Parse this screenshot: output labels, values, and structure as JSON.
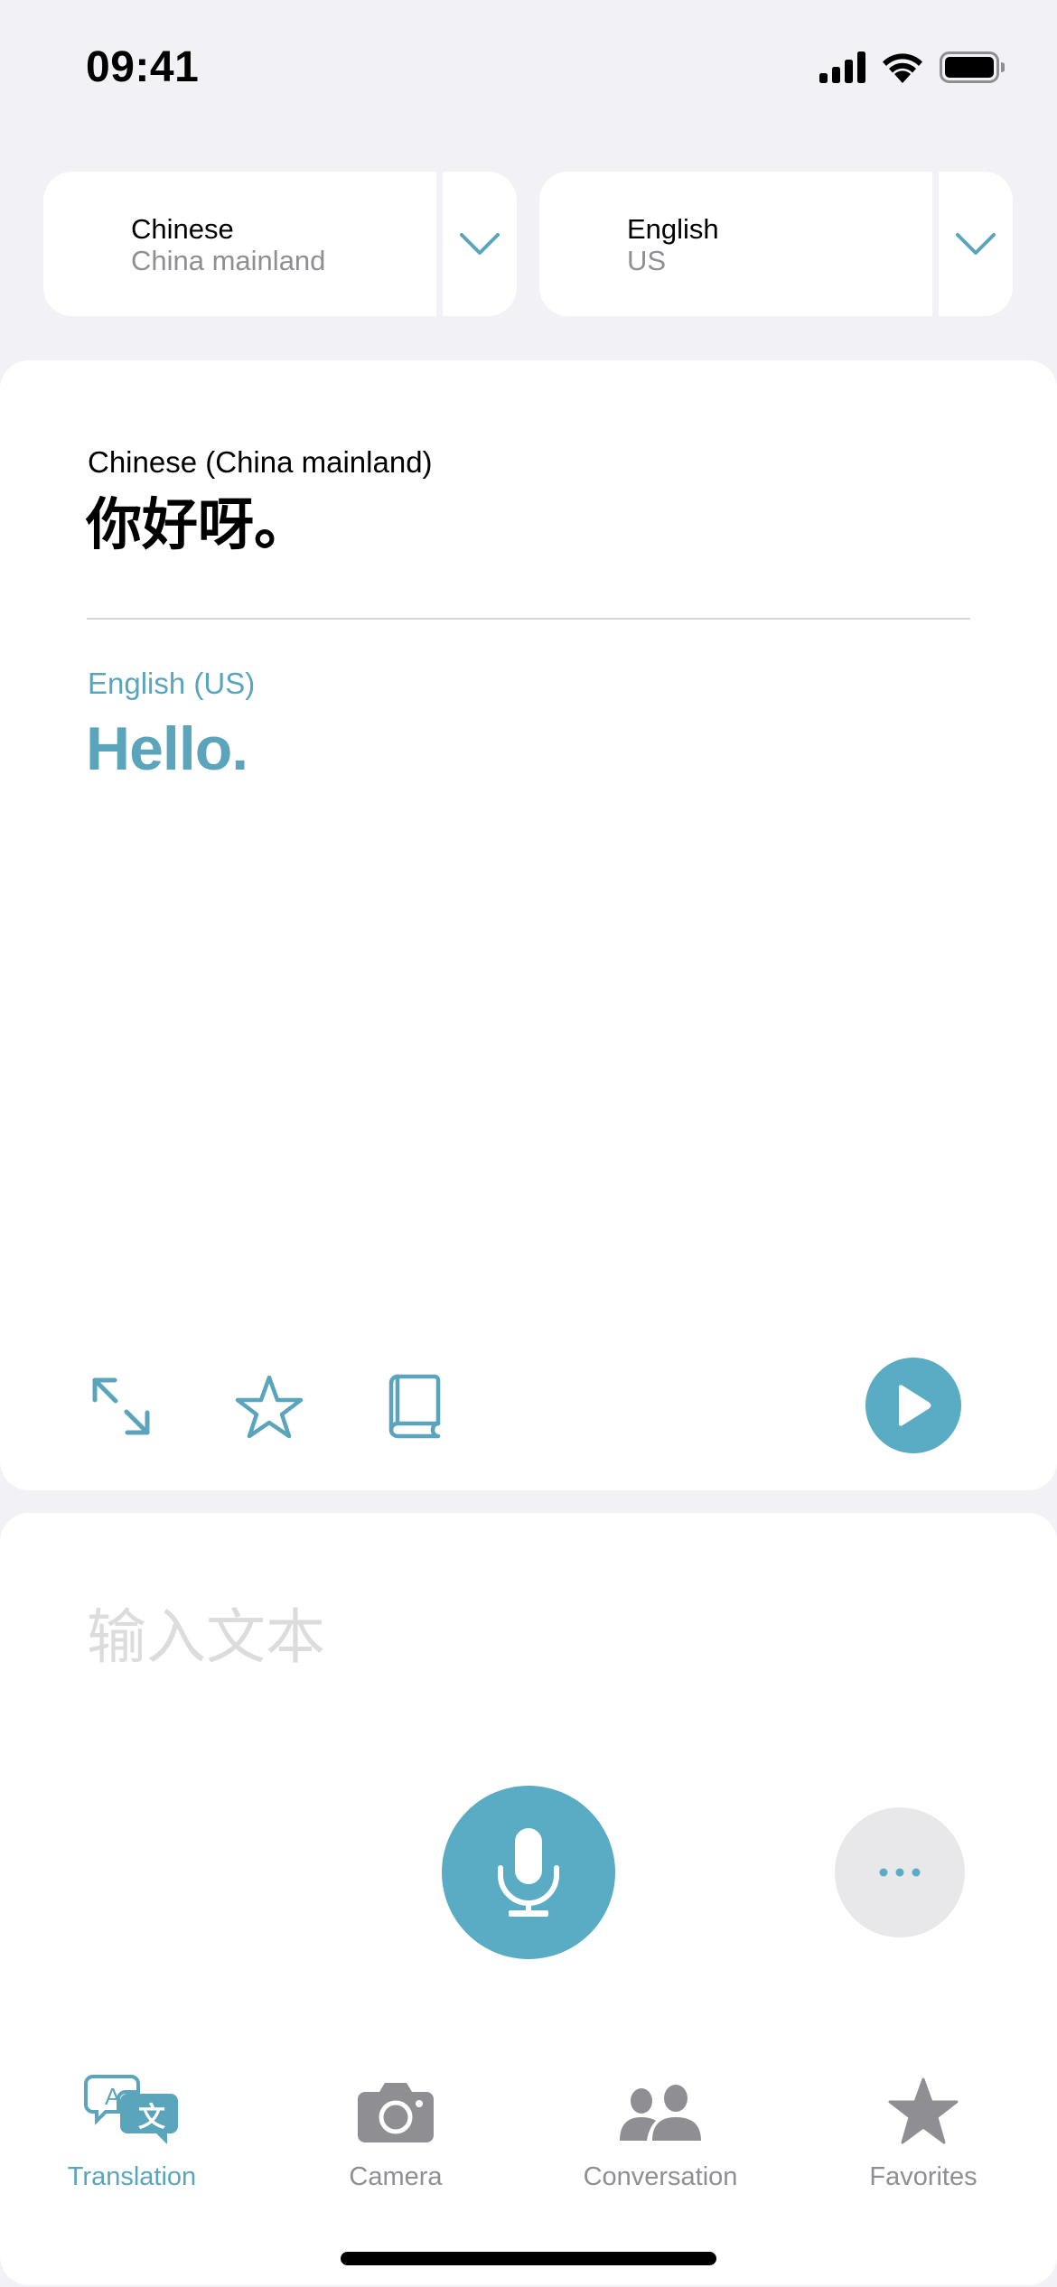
{
  "status_bar": {
    "time": "09:41",
    "icons": [
      "cellular-signal-icon",
      "wifi-icon",
      "battery-icon"
    ]
  },
  "language_selector": {
    "source": {
      "language": "Chinese",
      "region": "China mainland",
      "icon": "chevron-down-icon"
    },
    "target": {
      "language": "English",
      "region": "US",
      "icon": "chevron-down-icon"
    }
  },
  "translation": {
    "source_label": "Chinese (China mainland)",
    "source_text": "你好呀。",
    "target_label": "English (US)",
    "target_text": "Hello.",
    "actions": [
      "expand-icon",
      "favorite-star-icon",
      "dictionary-book-icon",
      "play-icon"
    ]
  },
  "input": {
    "value": "",
    "placeholder": "输入文本",
    "mic_icon": "microphone-icon",
    "more_icon": "ellipsis-icon"
  },
  "tab_bar": {
    "active": "Translation",
    "tabs": [
      {
        "label": "Translation",
        "icon": "translate-bubbles-icon"
      },
      {
        "label": "Camera",
        "icon": "camera-icon"
      },
      {
        "label": "Conversation",
        "icon": "people-icon"
      },
      {
        "label": "Favorites",
        "icon": "star-filled-icon"
      }
    ]
  },
  "colors": {
    "accent": "#5aabc4",
    "background": "#f2f2f6",
    "card": "#ffffff",
    "secondary_text": "#8e8e93",
    "placeholder": "#dcdcdc",
    "more_button_bg": "#e8e8ea"
  }
}
